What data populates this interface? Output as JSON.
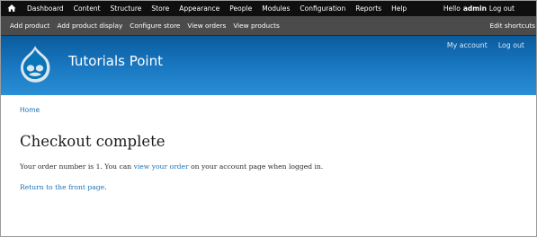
{
  "toolbar": {
    "menu": [
      "Dashboard",
      "Content",
      "Structure",
      "Store",
      "Appearance",
      "People",
      "Modules",
      "Configuration",
      "Reports",
      "Help"
    ],
    "greeting": "Hello",
    "username": "admin",
    "logout": "Log out"
  },
  "shortcuts": {
    "items": [
      "Add product",
      "Add product display",
      "Configure store",
      "View orders",
      "View products"
    ],
    "edit": "Edit shortcuts"
  },
  "header": {
    "site_name": "Tutorials Point",
    "my_account": "My account",
    "logout": "Log out",
    "brand_color": "#1674bd"
  },
  "breadcrumb": "Home",
  "page_title": "Checkout complete",
  "message": {
    "prefix": "Your order number is 1. You can ",
    "link": "view your order",
    "suffix": " on your account page when logged in."
  },
  "front": {
    "link": "Return to the front page",
    "suffix": "."
  }
}
